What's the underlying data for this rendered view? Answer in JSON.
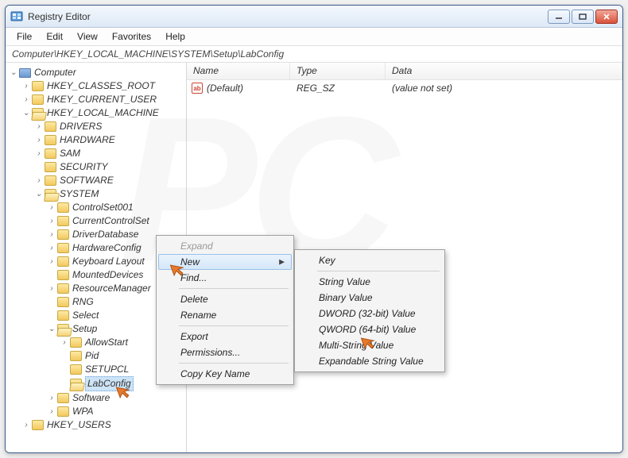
{
  "window": {
    "title": "Registry Editor"
  },
  "menu": {
    "file": "File",
    "edit": "Edit",
    "view": "View",
    "favorites": "Favorites",
    "help": "Help"
  },
  "address": "Computer\\HKEY_LOCAL_MACHINE\\SYSTEM\\Setup\\LabConfig",
  "tree": {
    "root": "Computer",
    "hkcr": "HKEY_CLASSES_ROOT",
    "hkcu": "HKEY_CURRENT_USER",
    "hklm": "HKEY_LOCAL_MACHINE",
    "drivers": "DRIVERS",
    "hardware": "HARDWARE",
    "sam": "SAM",
    "security": "SECURITY",
    "software": "SOFTWARE",
    "system": "SYSTEM",
    "cs001": "ControlSet001",
    "ccs": "CurrentControlSet",
    "drvdb": "DriverDatabase",
    "hwcfg": "HardwareConfig",
    "kbd": "Keyboard Layout",
    "mdev": "MountedDevices",
    "resman": "ResourceManager",
    "rng": "RNG",
    "select": "Select",
    "setup": "Setup",
    "allowstart": "AllowStart",
    "pid": "Pid",
    "setupcl": "SETUPCL",
    "labconfig": "LabConfig",
    "soft2": "Software",
    "wpa": "WPA",
    "hku": "HKEY_USERS"
  },
  "list": {
    "headers": {
      "name": "Name",
      "type": "Type",
      "data": "Data"
    },
    "row": {
      "icon": "ab",
      "name": "(Default)",
      "type": "REG_SZ",
      "data": "(value not set)"
    }
  },
  "ctx1": {
    "expand": "Expand",
    "new": "New",
    "find": "Find...",
    "delete": "Delete",
    "rename": "Rename",
    "export": "Export",
    "permissions": "Permissions...",
    "copykey": "Copy Key Name"
  },
  "ctx2": {
    "key": "Key",
    "string": "String Value",
    "binary": "Binary Value",
    "dword": "DWORD (32-bit) Value",
    "qword": "QWORD (64-bit) Value",
    "multi": "Multi-String Value",
    "expand": "Expandable String Value"
  }
}
